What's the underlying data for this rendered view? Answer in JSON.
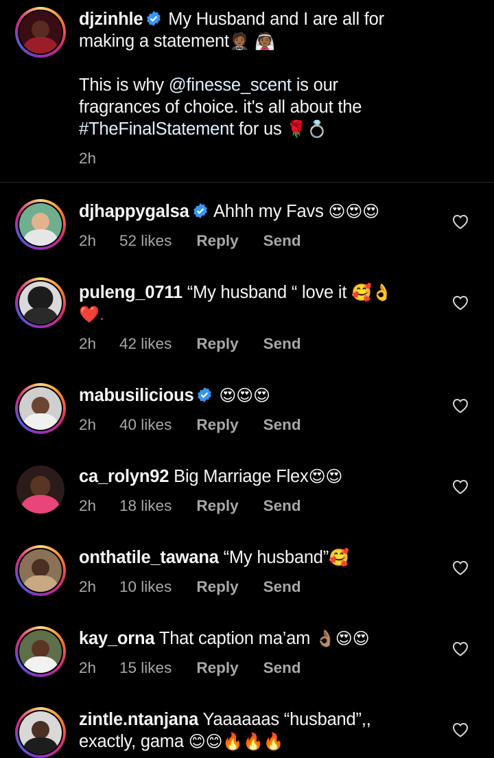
{
  "caption": {
    "username": "djzinhle",
    "line1_text": "My Husband and I are all for",
    "line2_text": "making a statement",
    "line2_emoji": "🤵🏾 👰🏾",
    "para_line1_pre": "This is why ",
    "para_mention": "@finesse_scent",
    "para_line1_post": " is our",
    "para_line2": "fragrances of choice. it's all about the",
    "para_hashtag": "#TheFinalStatement",
    "para_line3_post": " for us ",
    "para_line3_emoji": "🌹💍",
    "time": "2h"
  },
  "comments": [
    {
      "username": "djhappygalsa",
      "verified": true,
      "text": "Ahhh my Favs",
      "emoji": "😍😍😍",
      "text2": "",
      "time": "2h",
      "likes": "52 likes",
      "reply": "Reply",
      "send": "Send"
    },
    {
      "username": "puleng_0711",
      "verified": false,
      "text": "“My husband “ love it",
      "emoji": "🥰👌",
      "text2": "❤️.",
      "time": "2h",
      "likes": "42 likes",
      "reply": "Reply",
      "send": "Send"
    },
    {
      "username": "mabusilicious",
      "verified": true,
      "text": "",
      "emoji": "😍😍😍",
      "text2": "",
      "time": "2h",
      "likes": "40 likes",
      "reply": "Reply",
      "send": "Send"
    },
    {
      "username": "ca_rolyn92",
      "verified": false,
      "text": "Big Marriage Flex",
      "emoji": "😍😍",
      "text2": "",
      "time": "2h",
      "likes": "18 likes",
      "reply": "Reply",
      "send": "Send"
    },
    {
      "username": "onthatile_tawana",
      "verified": false,
      "text": "“My husband”",
      "emoji": "🥰",
      "text2": "",
      "time": "2h",
      "likes": "10 likes",
      "reply": "Reply",
      "send": "Send"
    },
    {
      "username": "kay_orna",
      "verified": false,
      "text": "That caption ma’am",
      "emoji": "👌🏽😍😍",
      "text2": "",
      "time": "2h",
      "likes": "15 likes",
      "reply": "Reply",
      "send": "Send"
    },
    {
      "username": "zintle.ntanjana",
      "verified": false,
      "text": "Yaaaaaas “husband”,,",
      "emoji": "",
      "text2": "exactly, gama",
      "emoji2": "😊😊🔥🔥🔥",
      "time": "",
      "likes": "",
      "reply": "",
      "send": ""
    }
  ],
  "colors": {
    "background": "#000000",
    "text": "#f5f5f5",
    "muted": "#a8a8a8",
    "verified": "#3897f0"
  }
}
